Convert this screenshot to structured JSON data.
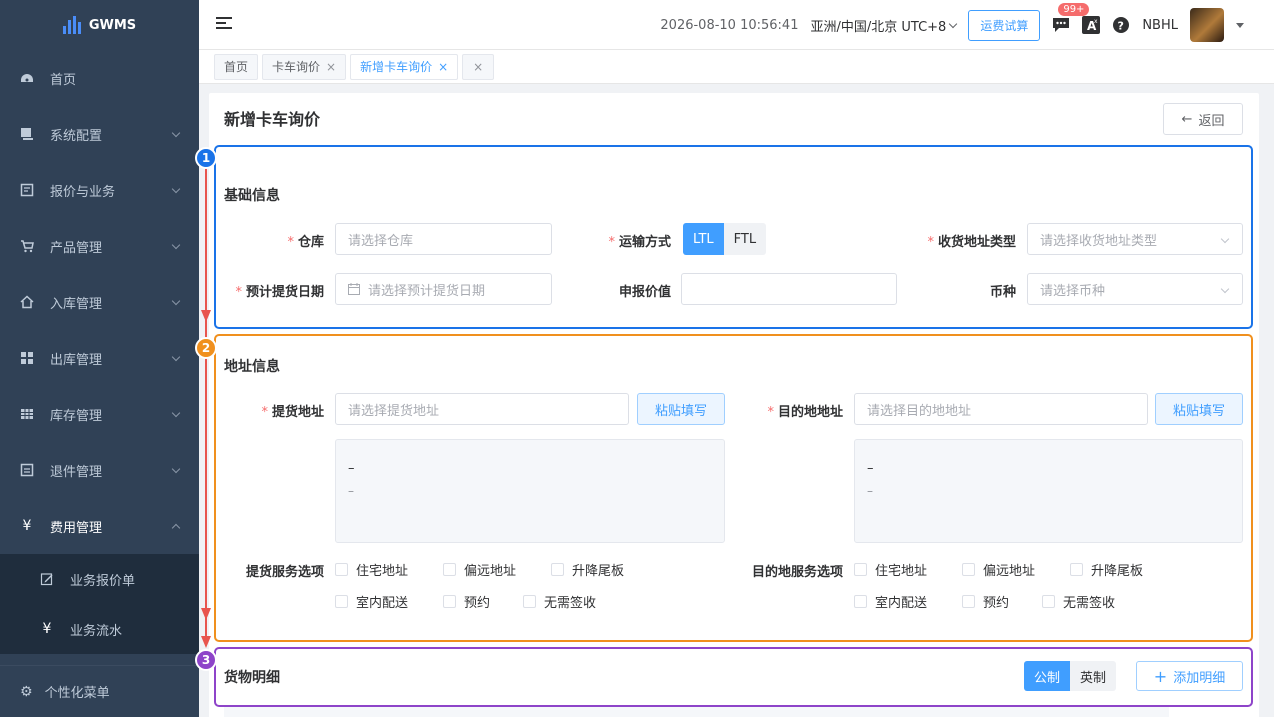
{
  "sidebar": {
    "logo": "GWMS",
    "items": [
      {
        "label": "首页",
        "icon": "dashboard-icon"
      },
      {
        "label": "系统配置",
        "icon": "settings-icon"
      },
      {
        "label": "报价与业务",
        "icon": "quote-icon"
      },
      {
        "label": "产品管理",
        "icon": "cart-icon"
      },
      {
        "label": "入库管理",
        "icon": "home-icon"
      },
      {
        "label": "出库管理",
        "icon": "grid-icon"
      },
      {
        "label": "库存管理",
        "icon": "table-icon"
      },
      {
        "label": "退件管理",
        "icon": "return-icon"
      },
      {
        "label": "费用管理",
        "icon": "yen-icon"
      }
    ],
    "sub_items": [
      {
        "label": "业务报价单",
        "icon": "edit-icon"
      },
      {
        "label": "业务流水",
        "icon": "yen-icon"
      }
    ],
    "bottom": "个性化菜单"
  },
  "topbar": {
    "datetime": "2026-08-10 10:56:41",
    "timezone": "亚洲/中国/北京 UTC+8",
    "freight_button": "运费试算",
    "badge": "99+",
    "user": "NBHL"
  },
  "tabs": [
    {
      "label": "首页",
      "active": false,
      "closable": false
    },
    {
      "label": "卡车询价",
      "active": false,
      "closable": true
    },
    {
      "label": "新增卡车询价",
      "active": true,
      "closable": true
    },
    {
      "label": "",
      "active": false,
      "closable": true
    }
  ],
  "page": {
    "title": "新增卡车询价",
    "back": "返回"
  },
  "basic": {
    "title": "基础信息",
    "warehouse_label": "仓库",
    "warehouse_placeholder": "请选择仓库",
    "transport_label": "运输方式",
    "transport_options": [
      "LTL",
      "FTL"
    ],
    "transport_selected": "LTL",
    "addr_type_label": "收货地址类型",
    "addr_type_placeholder": "请选择收货地址类型",
    "pickup_date_label": "预计提货日期",
    "pickup_date_placeholder": "请选择预计提货日期",
    "declared_label": "申报价值",
    "currency_label": "币种",
    "currency_placeholder": "请选择币种"
  },
  "address": {
    "title": "地址信息",
    "pickup_label": "提货地址",
    "pickup_placeholder": "请选择提货地址",
    "dest_label": "目的地地址",
    "dest_placeholder": "请选择目的地地址",
    "paste": "粘贴填写",
    "box_line1": "–",
    "box_line2": "–",
    "pickup_service_label": "提货服务选项",
    "dest_service_label": "目的地服务选项",
    "options": [
      "住宅地址",
      "偏远地址",
      "升降尾板",
      "室内配送",
      "预约",
      "无需签收"
    ]
  },
  "goods": {
    "title": "货物明细",
    "units": [
      "公制",
      "英制"
    ],
    "unit_selected": "公制",
    "add": "添加明细"
  },
  "annotations": {
    "colors": {
      "one": "#1a73e8",
      "two": "#f0901e",
      "three": "#8e44c9",
      "arrow": "#e8554e"
    },
    "labels": [
      "1",
      "2",
      "3"
    ]
  }
}
